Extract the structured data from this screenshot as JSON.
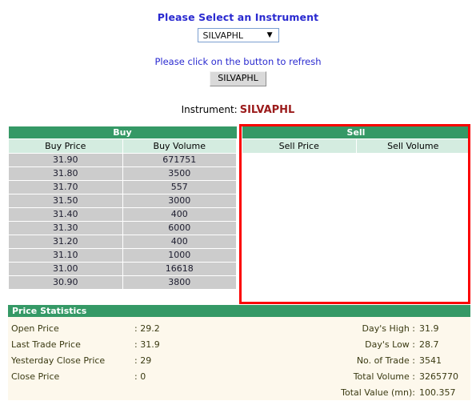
{
  "top": {
    "select_prompt": "Please Select an Instrument",
    "selected_instrument": "SILVAPHL",
    "dropdown_arrow": "▼",
    "refresh_prompt": "Please click on the button to refresh",
    "refresh_button_label": "SILVAPHL",
    "instrument_label": "Instrument:",
    "instrument_value": "SILVAPHL"
  },
  "colors": {
    "header_green": "#359966",
    "subheader_mint": "#d4ece0",
    "row_gray": "#cccccc",
    "stats_cream": "#fdf8ec",
    "highlight_red": "#fb0000",
    "link_blue": "#2a2ad0",
    "instrument_maroon": "#9b1b1b"
  },
  "buy_table": {
    "group_header": "Buy",
    "columns": [
      "Buy Price",
      "Buy Volume"
    ],
    "rows": [
      {
        "price": "31.90",
        "volume": "671751"
      },
      {
        "price": "31.80",
        "volume": "3500"
      },
      {
        "price": "31.70",
        "volume": "557"
      },
      {
        "price": "31.50",
        "volume": "3000"
      },
      {
        "price": "31.40",
        "volume": "400"
      },
      {
        "price": "31.30",
        "volume": "6000"
      },
      {
        "price": "31.20",
        "volume": "400"
      },
      {
        "price": "31.10",
        "volume": "1000"
      },
      {
        "price": "31.00",
        "volume": "16618"
      },
      {
        "price": "30.90",
        "volume": "3800"
      }
    ]
  },
  "sell_table": {
    "group_header": "Sell",
    "columns": [
      "Sell Price",
      "Sell Volume"
    ],
    "rows": []
  },
  "statistics": {
    "title": "Price Statistics",
    "left": [
      {
        "label": "Open Price",
        "value": ": 29.2"
      },
      {
        "label": "Last Trade Price",
        "value": ": 31.9"
      },
      {
        "label": "Yesterday Close Price",
        "value": ": 29"
      },
      {
        "label": "Close Price",
        "value": ": 0"
      }
    ],
    "right": [
      {
        "label": "Day's High :",
        "value": "31.9"
      },
      {
        "label": "Day's Low :",
        "value": "28.7"
      },
      {
        "label": "No. of Trade :",
        "value": "3541"
      },
      {
        "label": "Total Volume :",
        "value": "3265770"
      },
      {
        "label": "Total Value (mn):",
        "value": "100.357"
      }
    ]
  }
}
